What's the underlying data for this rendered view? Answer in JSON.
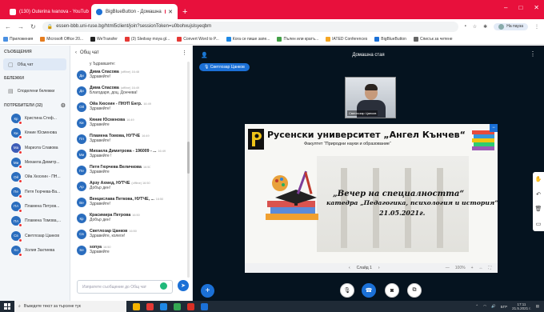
{
  "colors": {
    "browser_red": "#e8103c",
    "accent_blue": "#1b70d6",
    "main_bg": "#05131f"
  },
  "browser": {
    "tabs": [
      {
        "label": "(130) Outerina Ivanova - YouTub"
      },
      {
        "label": "BigBlueButton - Домашна"
      }
    ],
    "new_tab": "+",
    "window_controls": [
      "–",
      "□",
      "✕"
    ],
    "nav": {
      "back": "←",
      "forward": "→",
      "reload": "↻"
    },
    "url": "essen-bbb.uni-ruse.bg/html5client/join?sessionToken=u0bohxujslsyeqbm",
    "profile_label": "На пауза",
    "bookmarks": [
      {
        "label": "Приложения",
        "color": "#4a90e2"
      },
      {
        "label": "Microsoft Office 20...",
        "color": "#e57c1f"
      },
      {
        "label": "WeTransfer",
        "color": "#222222"
      },
      {
        "label": "(3) Sledvay moya gl...",
        "color": "#e53935"
      },
      {
        "label": "Convert Word to P...",
        "color": "#e53935"
      },
      {
        "label": "Кога се пише запе...",
        "color": "#1e88e5"
      },
      {
        "label": "Пълен или кратъ...",
        "color": "#43a047"
      },
      {
        "label": "IATED Conferences",
        "color": "#f5a623"
      },
      {
        "label": "BigBlueButton",
        "color": "#1b70d6"
      },
      {
        "label": "Списък за четене",
        "color": "#666666"
      }
    ]
  },
  "sidebar": {
    "messages_title": "СЪОБЩЕНИЯ",
    "public_chat": "Общ чат",
    "notes_title": "БЕЛЕЖКИ",
    "shared_notes": "Споделени бележки",
    "users_title": "ПОТРЕБИТЕЛИ (32)",
    "users": [
      {
        "initials": "Кр",
        "name": "Кристина Стеф...",
        "color": "#2a6dbe"
      },
      {
        "initials": "Ки",
        "name": "Кяние Юсменова",
        "color": "#2a6dbe"
      },
      {
        "initials": "Ма",
        "name": "Мариэта Славова",
        "color": "#3d5cb8"
      },
      {
        "initials": "Ми",
        "name": "Михаела Димитр...",
        "color": "#2a6dbe"
      },
      {
        "initials": "Ой",
        "name": "Ойа Хюсеин - ПН...",
        "color": "#2a6dbe"
      },
      {
        "initials": "Пе",
        "name": "Петя Гюрчева-Ва...",
        "color": "#2a6dbe"
      },
      {
        "initials": "Пл",
        "name": "Пламена Петров...",
        "color": "#2a6dbe"
      },
      {
        "initials": "Пл",
        "name": "Пламена Томова,...",
        "color": "#2a6dbe"
      },
      {
        "initials": "Св",
        "name": "Светлозар Цанков",
        "color": "#2a6dbe"
      },
      {
        "initials": "Хо",
        "name": "Холия Захтиева",
        "color": "#2a6dbe"
      }
    ]
  },
  "chat": {
    "back_label": "‹",
    "title": "Общ чат",
    "more": "⋮",
    "messages": [
      {
        "initials": "",
        "name": "",
        "time": "",
        "text": "у Ъдравшите:"
      },
      {
        "initials": "Ди",
        "name": "Дима Спасова",
        "time": "(offline) 16:48",
        "text": "Здравейте!"
      },
      {
        "initials": "Ди",
        "name": "Дима Спасова",
        "time": "(offline) 16:49",
        "text": "Благодаря, доц. Дончева!"
      },
      {
        "initials": "Ой",
        "name": "Ойа Хюсеин - ПНУП Енгр.",
        "time": "16:49",
        "text": "Здравейте!"
      },
      {
        "initials": "Ки",
        "name": "Кяние Юсменова",
        "time": "16:49",
        "text": "Здравейте"
      },
      {
        "initials": "Пл",
        "name": "Пламена Томова, НУТЧЕ",
        "time": "16:49",
        "text": "Здравейте!"
      },
      {
        "initials": "Ми",
        "name": "Михаела Димитрова - 196009 - ...",
        "time": "16:49",
        "text": "Здравейте !"
      },
      {
        "initials": "Пе",
        "name": "Петя Гюрчева Величкова",
        "time": "16:50",
        "text": "Здравейте"
      },
      {
        "initials": "Ар",
        "name": "Арзу Ахмед, НУТЧЕ",
        "time": "(offline) 16:50",
        "text": "Добър ден!"
      },
      {
        "initials": "Ве",
        "name": "Венцислава Петкова, НУТЧЕ, ...",
        "time": "16:50",
        "text": "Здравейте!"
      },
      {
        "initials": "Кр",
        "name": "Красимира Петрова",
        "time": "16:50",
        "text": "Добър ден!"
      },
      {
        "initials": "Св",
        "name": "Светлозар Цанков",
        "time": "16:50",
        "text": "Здравейте, колеги!"
      },
      {
        "initials": "Se",
        "name": "sonya",
        "time": "16:50",
        "text": "Здравейте"
      }
    ],
    "input_placeholder": "Изпратете съобщение до Общ чат",
    "send_icon": "➤"
  },
  "main": {
    "room_title": "Домашна стая",
    "presenter": "Светлозар Цанков",
    "webcam_name": "Светлозар Цанков",
    "slide": {
      "university": "Русенски университет „Ангел Кънчев“",
      "faculty": "Факултет “Природни науки и образование“",
      "headline": "„Вечер на специалността“",
      "department": "катедра „Педагогика, психология и история“",
      "date": "21.05.2021г."
    },
    "slide_bar": {
      "prev": "‹",
      "page": "Слайд 1",
      "next": "›",
      "zoom_minus": "—",
      "zoom": "100%",
      "zoom_plus": "+",
      "fit": "↔",
      "fullscreen": "⛶"
    },
    "tools": [
      "✋",
      "↶",
      "🗑",
      "▭"
    ],
    "plus": "+",
    "controls": [
      {
        "name": "mic-button",
        "icon": "🎙",
        "blue": false
      },
      {
        "name": "phone-button",
        "icon": "☎",
        "blue": true
      },
      {
        "name": "camera-button",
        "icon": "◙",
        "blue": false
      },
      {
        "name": "screenshare-button",
        "icon": "⧉",
        "blue": false
      }
    ]
  },
  "taskbar": {
    "search_placeholder": "Въведете текст за търсене тук",
    "apps": [
      "#f4b400",
      "#e53935",
      "#1e88e5",
      "#34a853",
      "#d93025",
      "#1b70d6"
    ],
    "lang": "БГР",
    "time": "17:11",
    "date": "21.5.2021 г."
  }
}
